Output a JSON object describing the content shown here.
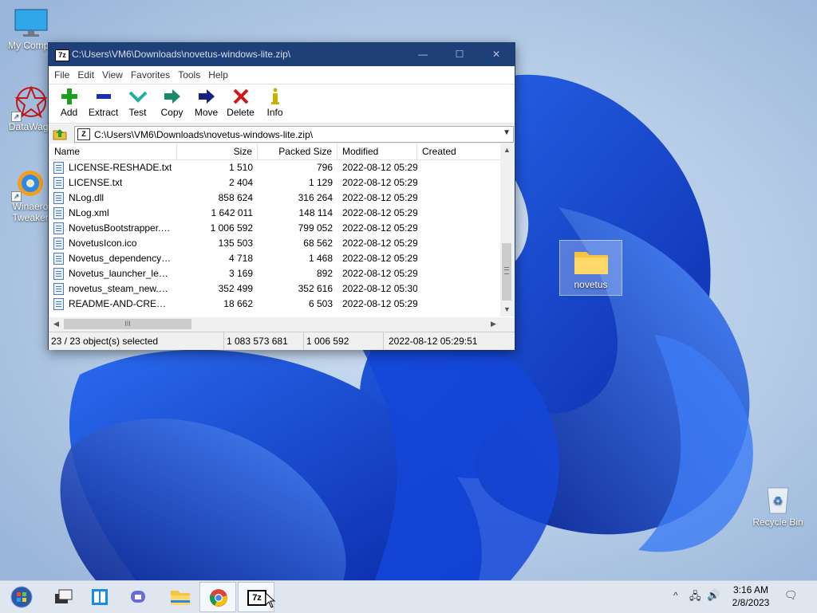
{
  "desktop": {
    "icons": [
      {
        "label": "My Compu"
      },
      {
        "label": "DataWago"
      },
      {
        "label": "Winaero Tweaker"
      },
      {
        "label": "novetus"
      },
      {
        "label": "Recycle Bin"
      }
    ]
  },
  "window": {
    "app_icon": "7z",
    "title": "C:\\Users\\VM6\\Downloads\\novetus-windows-lite.zip\\",
    "buttons": {
      "minimize": "—",
      "maximize": "☐",
      "close": "✕"
    }
  },
  "menu": [
    "File",
    "Edit",
    "View",
    "Favorites",
    "Tools",
    "Help"
  ],
  "toolbar": [
    {
      "label": "Add",
      "icon": "plus-icon",
      "color": "#1ea01e"
    },
    {
      "label": "Extract",
      "icon": "minus-icon",
      "color": "#1a2fb0"
    },
    {
      "label": "Test",
      "icon": "check-icon",
      "color": "#20b0a0"
    },
    {
      "label": "Copy",
      "icon": "copy-arrow-icon",
      "color": "#1a8a6a"
    },
    {
      "label": "Move",
      "icon": "move-arrow-icon",
      "color": "#1a2080"
    },
    {
      "label": "Delete",
      "icon": "x-icon",
      "color": "#d01818"
    },
    {
      "label": "Info",
      "icon": "info-icon",
      "color": "#c8b400"
    }
  ],
  "address": {
    "path": "C:\\Users\\VM6\\Downloads\\novetus-windows-lite.zip\\",
    "zip_icon": "Z"
  },
  "columns": {
    "name": "Name",
    "size": "Size",
    "packed": "Packed Size",
    "modified": "Modified",
    "created": "Created"
  },
  "files": [
    {
      "name": "LICENSE-RESHADE.txt",
      "size": "1 510",
      "packed": "796",
      "modified": "2022-08-12 05:29",
      "created": ""
    },
    {
      "name": "LICENSE.txt",
      "size": "2 404",
      "packed": "1 129",
      "modified": "2022-08-12 05:29",
      "created": ""
    },
    {
      "name": "NLog.dll",
      "size": "858 624",
      "packed": "316 264",
      "modified": "2022-08-12 05:29",
      "created": ""
    },
    {
      "name": "NLog.xml",
      "size": "1 642 011",
      "packed": "148 114",
      "modified": "2022-08-12 05:29",
      "created": ""
    },
    {
      "name": "NovetusBootstrapper.exe",
      "size": "1 006 592",
      "packed": "799 052",
      "modified": "2022-08-12 05:29",
      "created": ""
    },
    {
      "name": "NovetusIcon.ico",
      "size": "135 503",
      "packed": "68 562",
      "modified": "2022-08-12 05:29",
      "created": ""
    },
    {
      "name": "Novetus_dependency_i...",
      "size": "4 718",
      "packed": "1 468",
      "modified": "2022-08-12 05:29",
      "created": ""
    },
    {
      "name": "Novetus_launcher_lega...",
      "size": "3 169",
      "packed": "892",
      "modified": "2022-08-12 05:29",
      "created": ""
    },
    {
      "name": "novetus_steam_new.png",
      "size": "352 499",
      "packed": "352 616",
      "modified": "2022-08-12 05:30",
      "created": ""
    },
    {
      "name": "README-AND-CREDITS...",
      "size": "18 662",
      "packed": "6 503",
      "modified": "2022-08-12 05:29",
      "created": ""
    }
  ],
  "scroll": {
    "up": "▲",
    "down": "▼",
    "left": "◀",
    "right": "▶",
    "h_grip": "III"
  },
  "status": {
    "selected": "23 / 23 object(s) selected",
    "total_size": "1 083 573 681",
    "packed_size": "1 006 592",
    "date": "2022-08-12 05:29:51"
  },
  "taskbar": {
    "items": [
      "start-orb-icon",
      "task-view-icon",
      "snap-layout-icon",
      "teams-chat-icon",
      "file-explorer-icon",
      "chrome-icon",
      "7zip-icon"
    ],
    "seven_zip_label": "7z",
    "time": "3:16 AM",
    "date": "2/8/2023",
    "tray": {
      "chevron": "^",
      "network": "🖧",
      "volume": "🔊",
      "notification": "🗨"
    }
  }
}
